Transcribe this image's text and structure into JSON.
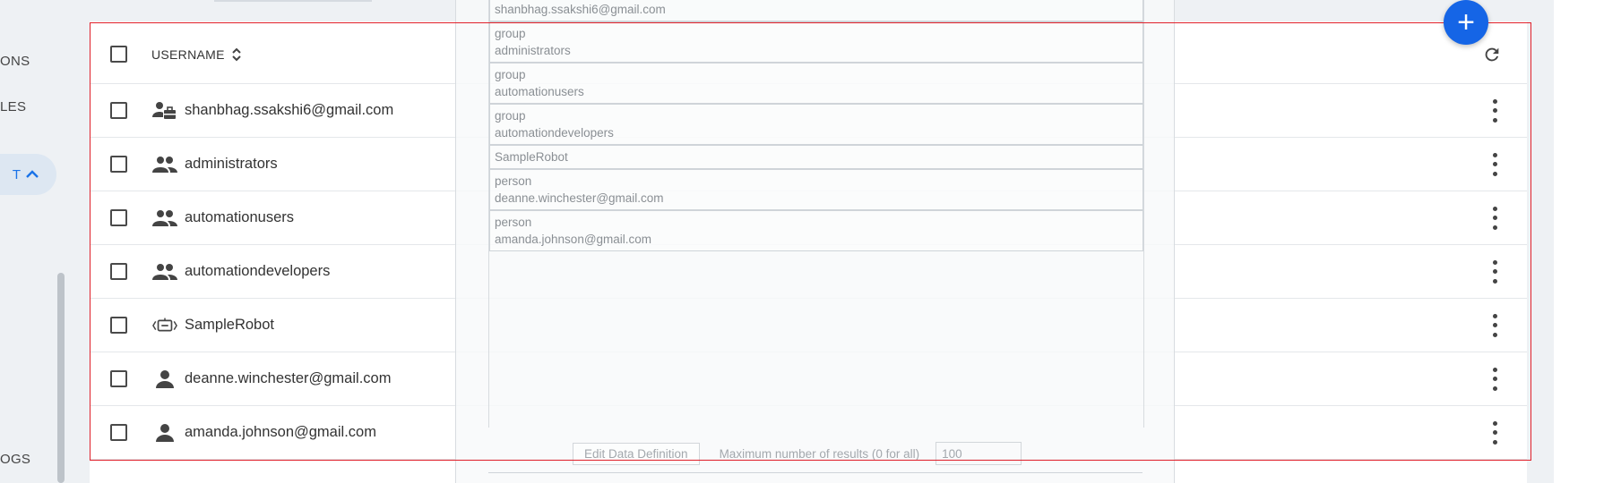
{
  "sidebar": {
    "items": [
      {
        "label": "ONS"
      },
      {
        "label": "LES"
      },
      {
        "label": "T"
      },
      {
        "label": "OGS"
      }
    ]
  },
  "table": {
    "header": {
      "username_label": "USERNAME"
    },
    "rows": [
      {
        "name": "shanbhag.ssakshi6@gmail.com",
        "type_icon": "admin-user-icon"
      },
      {
        "name": "administrators",
        "type_icon": "group-icon"
      },
      {
        "name": "automationusers",
        "type_icon": "group-icon"
      },
      {
        "name": "automationdevelopers",
        "type_icon": "group-icon"
      },
      {
        "name": "SampleRobot",
        "type_icon": "robot-icon"
      },
      {
        "name": "deanne.winchester@gmail.com",
        "type_icon": "person-icon"
      },
      {
        "name": "amanda.johnson@gmail.com",
        "type_icon": "person-icon"
      }
    ]
  },
  "overlay": {
    "items": [
      {
        "line1": "shanbhag.ssakshi6@gmail.com"
      },
      {
        "line1": "group",
        "line2": "administrators"
      },
      {
        "line1": "group",
        "line2": "automationusers"
      },
      {
        "line1": "group",
        "line2": "automationdevelopers"
      },
      {
        "line1": "SampleRobot"
      },
      {
        "line1": "person",
        "line2": "deanne.winchester@gmail.com"
      },
      {
        "line1": "person",
        "line2": "amanda.johnson@gmail.com"
      }
    ],
    "edit_button": "Edit Data Definition",
    "max_label": "Maximum number of results (0 for all)",
    "max_value": "100"
  },
  "fab": {
    "label": "+"
  },
  "colors": {
    "accent": "#1565e6",
    "selection": "#e0202a",
    "active_nav": "#1a73e8"
  }
}
